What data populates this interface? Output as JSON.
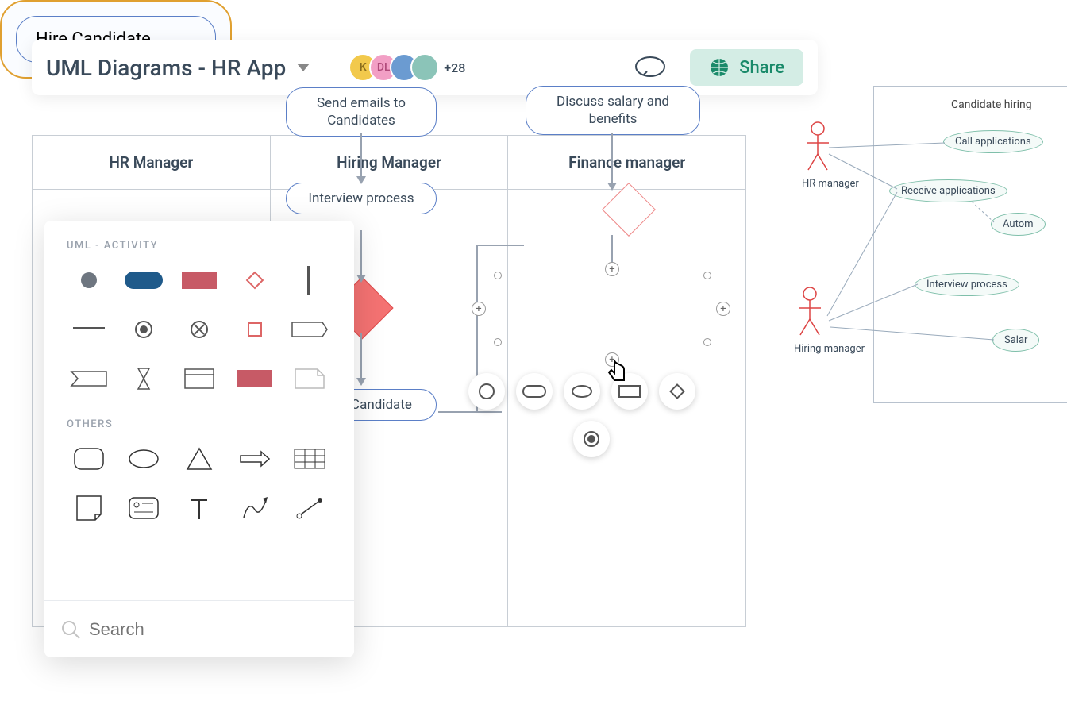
{
  "header": {
    "doc_title": "UML Diagrams - HR App",
    "avatars": [
      {
        "label": "K"
      },
      {
        "label": "DL"
      },
      {
        "label": ""
      },
      {
        "label": ""
      }
    ],
    "more_count": "+28",
    "share_label": "Share"
  },
  "swimlanes": {
    "lanes": [
      "HR Manager",
      "Hiring Manager",
      "Finance manager"
    ],
    "nodes": {
      "emails": "Send emails to Candidates",
      "interview": "Interview process",
      "select": "Select Candidate",
      "discuss": "Discuss salary and benefits",
      "hire": "Hire Candidate"
    }
  },
  "shapes_panel": {
    "section1_title": "UML - ACTIVITY",
    "section2_title": "OTHERS",
    "search_placeholder": "Search"
  },
  "usecase": {
    "title": "Candidate hiring",
    "actors": [
      "HR manager",
      "Hiring manager"
    ],
    "cases": [
      "Call applications",
      "Receive applications",
      "Autom",
      "Interview process",
      "Salar"
    ]
  }
}
